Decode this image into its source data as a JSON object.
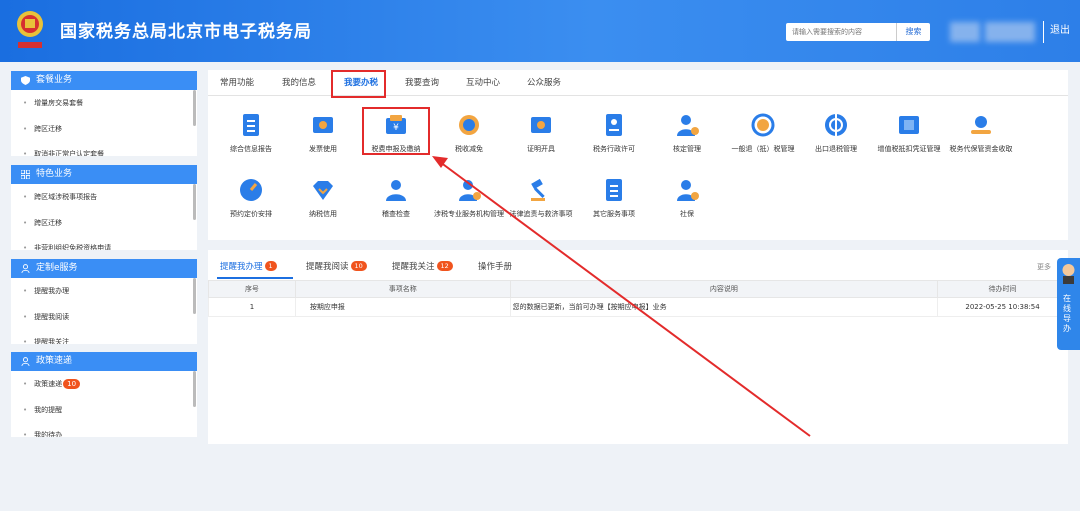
{
  "header": {
    "title": "国家税务总局北京市电子税务局",
    "search_placeholder": "请输入需要搜索的内容",
    "search_button": "搜索",
    "logout": "退出"
  },
  "sidebar": {
    "sections": [
      {
        "title": "套餐业务",
        "items": [
          "增量房交易套餐",
          "跨区迁移",
          "取消非正常户认定套餐"
        ]
      },
      {
        "title": "特色业务",
        "items": [
          "跨区域涉税事项报告",
          "跨区迁移",
          "非营利组织免税资格申请"
        ]
      },
      {
        "title": "定制e服务",
        "items": [
          "提醒我办理",
          "提醒我阅读",
          "提醒我关注"
        ]
      },
      {
        "title": "政策速递",
        "items": [
          "政策速递",
          "我的提醒",
          "我的待办"
        ],
        "badge": "10"
      }
    ]
  },
  "main": {
    "tabs": [
      "常用功能",
      "我的信息",
      "我要办税",
      "我要查询",
      "互动中心",
      "公众服务"
    ],
    "functions_row1": [
      "综合信息报告",
      "发票使用",
      "税费申报及缴纳",
      "税收减免",
      "证明开具",
      "税务行政许可",
      "核定管理",
      "一般退（抵）税管理",
      "出口退税管理",
      "增值税抵扣凭证管理",
      "税务代保管资金收取"
    ],
    "functions_row2": [
      "预约定价安排",
      "纳税信用",
      "稽查检查",
      "涉税专业服务机构管理",
      "法律追责与救济事项",
      "其它服务事项",
      "社保"
    ]
  },
  "reminders": {
    "tabs": [
      {
        "label": "提醒我办理",
        "count": "1"
      },
      {
        "label": "提醒我阅读",
        "count": "10"
      },
      {
        "label": "提醒我关注",
        "count": "12"
      },
      {
        "label": "操作手册",
        "count": ""
      }
    ],
    "more": "更多",
    "columns": [
      "序号",
      "事项名称",
      "内容说明",
      "待办时间"
    ],
    "rows": [
      {
        "no": "1",
        "name": "按期应申报",
        "desc": "您的数据已更新，当前可办理【按期应申报】业务",
        "time": "2022-05-25 10:38:54"
      }
    ]
  },
  "guide": {
    "label": "在线导办"
  },
  "colors": {
    "primary": "#1c6fe0",
    "header": "#2d7fe8",
    "badge": "#f0541e",
    "highlight": "#e32b2b"
  }
}
